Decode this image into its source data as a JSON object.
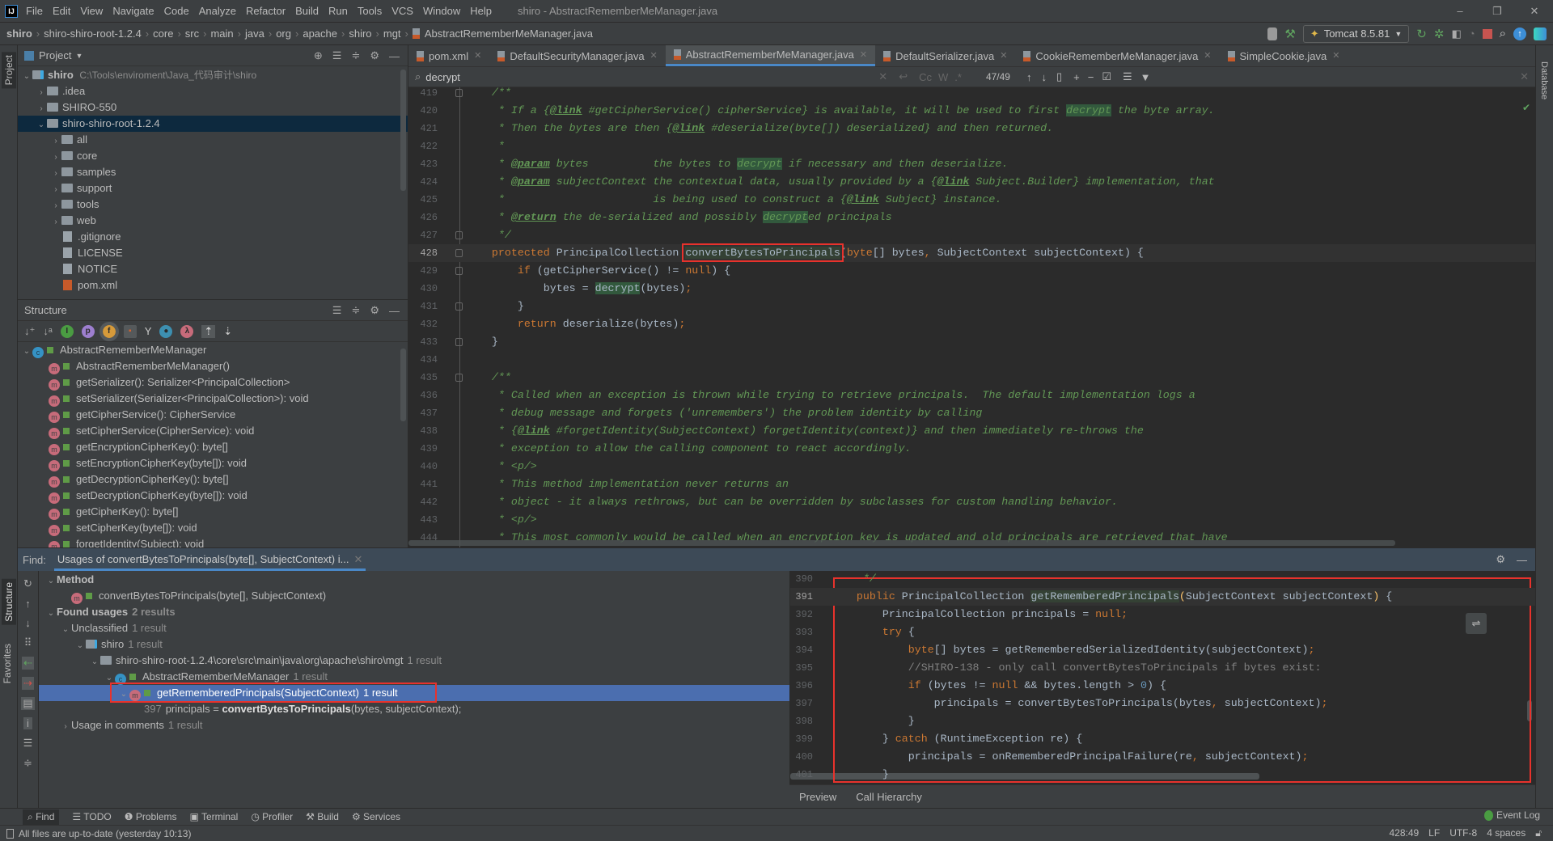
{
  "window": {
    "title": "shiro - AbstractRememberMeManager.java",
    "minimize": "–",
    "maximize": "❐",
    "close": "✕"
  },
  "menu": [
    "File",
    "Edit",
    "View",
    "Navigate",
    "Code",
    "Analyze",
    "Refactor",
    "Build",
    "Run",
    "Tools",
    "VCS",
    "Window",
    "Help"
  ],
  "breadcrumb": [
    "shiro",
    "shiro-shiro-root-1.2.4",
    "core",
    "src",
    "main",
    "java",
    "org",
    "apache",
    "shiro",
    "mgt",
    "AbstractRememberMeManager.java"
  ],
  "toolbar": {
    "run_config": "Tomcat 8.5.81"
  },
  "left_strip": {
    "project": "Project",
    "structure": "Structure",
    "favorites": "Favorites"
  },
  "right_strip": {
    "database": "Database"
  },
  "project": {
    "title": "Project",
    "root": {
      "name": "shiro",
      "path": "C:\\Tools\\enviroment\\Java_代码审计\\shiro"
    },
    "items": [
      {
        "name": ".idea",
        "type": "folder",
        "depth": 1,
        "arrow": "›"
      },
      {
        "name": "SHIRO-550",
        "type": "folder",
        "depth": 1,
        "arrow": "›"
      },
      {
        "name": "shiro-shiro-root-1.2.4",
        "type": "folder",
        "depth": 1,
        "arrow": "⌄",
        "selected": true
      },
      {
        "name": "all",
        "type": "folder",
        "depth": 2,
        "arrow": "›"
      },
      {
        "name": "core",
        "type": "folder",
        "depth": 2,
        "arrow": "›"
      },
      {
        "name": "samples",
        "type": "folder",
        "depth": 2,
        "arrow": "›"
      },
      {
        "name": "support",
        "type": "folder",
        "depth": 2,
        "arrow": "›"
      },
      {
        "name": "tools",
        "type": "folder",
        "depth": 2,
        "arrow": "›"
      },
      {
        "name": "web",
        "type": "folder",
        "depth": 2,
        "arrow": "›"
      },
      {
        "name": ".gitignore",
        "type": "file",
        "depth": 2,
        "arrow": ""
      },
      {
        "name": "LICENSE",
        "type": "file",
        "depth": 2,
        "arrow": ""
      },
      {
        "name": "NOTICE",
        "type": "file",
        "depth": 2,
        "arrow": ""
      },
      {
        "name": "pom.xml",
        "type": "xml",
        "depth": 2,
        "arrow": ""
      }
    ]
  },
  "structure": {
    "title": "Structure",
    "class_name": "AbstractRememberMeManager",
    "members": [
      "AbstractRememberMeManager()",
      "getSerializer(): Serializer<PrincipalCollection>",
      "setSerializer(Serializer<PrincipalCollection>): void",
      "getCipherService(): CipherService",
      "setCipherService(CipherService): void",
      "getEncryptionCipherKey(): byte[]",
      "setEncryptionCipherKey(byte[]): void",
      "getDecryptionCipherKey(): byte[]",
      "setDecryptionCipherKey(byte[]): void",
      "getCipherKey(): byte[]",
      "setCipherKey(byte[]): void",
      "forgetIdentity(Subject): void"
    ]
  },
  "tabs": [
    {
      "label": "pom.xml",
      "icon": "xml-file-icon"
    },
    {
      "label": "DefaultSecurityManager.java",
      "icon": "java-file-icon"
    },
    {
      "label": "AbstractRememberMeManager.java",
      "icon": "java-file-icon",
      "active": true
    },
    {
      "label": "DefaultSerializer.java",
      "icon": "java-file-icon"
    },
    {
      "label": "CookieRememberMeManager.java",
      "icon": "java-file-icon"
    },
    {
      "label": "SimpleCookie.java",
      "icon": "java-file-icon"
    }
  ],
  "search": {
    "query": "decrypt",
    "match_count": "47/49",
    "case_label": "Cc",
    "words_label": "W",
    "regex_label": ".*"
  },
  "editor": {
    "current_line": 428,
    "lines": [
      {
        "n": "419",
        "t": [
          [
            "    /**",
            "c"
          ]
        ]
      },
      {
        "n": "420",
        "t": [
          [
            "     * If a {",
            "c"
          ],
          [
            "@link",
            "ct"
          ],
          [
            " #getCipherService() cipherService} is available, it will be used to first ",
            "c"
          ],
          [
            "decrypt",
            "cm"
          ],
          [
            " the byte array.",
            "c"
          ]
        ]
      },
      {
        "n": "421",
        "t": [
          [
            "     * Then the bytes are then {",
            "c"
          ],
          [
            "@link",
            "ct"
          ],
          [
            " #deserialize(byte[]) deserialized} and then returned.",
            "c"
          ]
        ]
      },
      {
        "n": "422",
        "t": [
          [
            "     *",
            "c"
          ]
        ]
      },
      {
        "n": "423",
        "t": [
          [
            "     * ",
            "c"
          ],
          [
            "@param",
            "ct"
          ],
          [
            " bytes          the bytes to ",
            "c"
          ],
          [
            "decrypt",
            "cm"
          ],
          [
            " if necessary and then deserialize.",
            "c"
          ]
        ]
      },
      {
        "n": "424",
        "t": [
          [
            "     * ",
            "c"
          ],
          [
            "@param",
            "ct"
          ],
          [
            " subjectContext the contextual data, usually provided by a {",
            "c"
          ],
          [
            "@link",
            "ct"
          ],
          [
            " Subject.Builder} implementation, that",
            "c"
          ]
        ]
      },
      {
        "n": "425",
        "t": [
          [
            "     *                       is being used to construct a {",
            "c"
          ],
          [
            "@link",
            "ct"
          ],
          [
            " Subject} instance.",
            "c"
          ]
        ]
      },
      {
        "n": "426",
        "t": [
          [
            "     * ",
            "c"
          ],
          [
            "@return",
            "ct"
          ],
          [
            " the de-serialized and possibly ",
            "c"
          ],
          [
            "decrypt",
            "cm"
          ],
          [
            "ed principals",
            "c"
          ]
        ]
      },
      {
        "n": "427",
        "t": [
          [
            "     */",
            "c"
          ]
        ]
      },
      {
        "n": "428",
        "t": [
          [
            "    ",
            ""
          ],
          [
            "protected",
            "k"
          ],
          [
            " PrincipalCollection ",
            ""
          ],
          [
            "convertBytesToPrincipals",
            "box"
          ],
          [
            "(",
            ""
          ],
          [
            "byte",
            "k"
          ],
          [
            "[] bytes",
            ""
          ],
          [
            ", ",
            "k"
          ],
          [
            "SubjectContext subjectContext) {",
            ""
          ]
        ]
      },
      {
        "n": "429",
        "t": [
          [
            "        ",
            ""
          ],
          [
            "if",
            "k"
          ],
          [
            " (getCipherService() != ",
            ""
          ],
          [
            "null",
            "k"
          ],
          [
            ") {",
            ""
          ]
        ]
      },
      {
        "n": "430",
        "t": [
          [
            "            bytes = ",
            ""
          ],
          [
            "decrypt",
            "m"
          ],
          [
            "(bytes)",
            ""
          ],
          [
            ";",
            "k"
          ]
        ]
      },
      {
        "n": "431",
        "t": [
          [
            "        }",
            ""
          ]
        ]
      },
      {
        "n": "432",
        "t": [
          [
            "        ",
            ""
          ],
          [
            "return",
            "k"
          ],
          [
            " deserialize(bytes)",
            ""
          ],
          [
            ";",
            "k"
          ]
        ]
      },
      {
        "n": "433",
        "t": [
          [
            "    }",
            ""
          ]
        ]
      },
      {
        "n": "434",
        "t": [
          [
            "",
            ""
          ]
        ]
      },
      {
        "n": "435",
        "t": [
          [
            "    /**",
            "c"
          ]
        ]
      },
      {
        "n": "436",
        "t": [
          [
            "     * Called when an exception is thrown while trying to retrieve principals.  The default implementation logs a",
            "c"
          ]
        ]
      },
      {
        "n": "437",
        "t": [
          [
            "     * debug message and forgets ('unremembers') the problem identity by calling",
            "c"
          ]
        ]
      },
      {
        "n": "438",
        "t": [
          [
            "     * {",
            "c"
          ],
          [
            "@link",
            "ct"
          ],
          [
            " #forgetIdentity(SubjectContext) forgetIdentity(context)} and then immediately re-throws the",
            "c"
          ]
        ]
      },
      {
        "n": "439",
        "t": [
          [
            "     * exception to allow the calling component to react accordingly.",
            "c"
          ]
        ]
      },
      {
        "n": "440",
        "t": [
          [
            "     * <p/>",
            "c"
          ]
        ]
      },
      {
        "n": "441",
        "t": [
          [
            "     * This method implementation never returns an",
            "c"
          ]
        ]
      },
      {
        "n": "442",
        "t": [
          [
            "     * object - it always rethrows, but can be overridden by subclasses for custom handling behavior.",
            "c"
          ]
        ]
      },
      {
        "n": "443",
        "t": [
          [
            "     * <p/>",
            "c"
          ]
        ]
      },
      {
        "n": "444",
        "t": [
          [
            "     * This most commonly would be called when an encryption key is updated and old principals are retrieved that have",
            "c"
          ]
        ]
      }
    ]
  },
  "find": {
    "label": "Find:",
    "tab_title": "Usages of convertBytesToPrincipals(byte[], SubjectContext) i...",
    "rows": [
      {
        "depth": 0,
        "arrow": "⌄",
        "icon": "",
        "text": "Method",
        "bold": true,
        "count": ""
      },
      {
        "depth": 1,
        "arrow": "",
        "icon": "method",
        "text": "convertBytesToPrincipals(byte[], SubjectContext)",
        "count": ""
      },
      {
        "depth": 0,
        "arrow": "⌄",
        "icon": "",
        "text": "Found usages",
        "bold": true,
        "count": "2 results"
      },
      {
        "depth": 1,
        "arrow": "⌄",
        "icon": "",
        "text": "Unclassified",
        "count": "1 result"
      },
      {
        "depth": 2,
        "arrow": "⌄",
        "icon": "module",
        "text": "shiro",
        "count": "1 result"
      },
      {
        "depth": 3,
        "arrow": "⌄",
        "icon": "folder",
        "text": "shiro-shiro-root-1.2.4\\core\\src\\main\\java\\org\\apache\\shiro\\mgt",
        "count": "1 result"
      },
      {
        "depth": 4,
        "arrow": "⌄",
        "icon": "class",
        "text": "AbstractRememberMeManager",
        "count": "1 result"
      },
      {
        "depth": 5,
        "arrow": "⌄",
        "icon": "method",
        "text": "getRememberedPrincipals(SubjectContext)",
        "count": "1 result",
        "selected": true
      },
      {
        "depth": 6,
        "arrow": "",
        "icon": "",
        "line": "397",
        "pre": "principals = ",
        "match": "convertBytesToPrincipals",
        "post": "(bytes, subjectContext);"
      },
      {
        "depth": 1,
        "arrow": "›",
        "icon": "",
        "text": "Usage in comments",
        "count": "1 result"
      }
    ]
  },
  "preview": {
    "current_line": 391,
    "tabs": [
      "Preview",
      "Call Hierarchy"
    ],
    "lines": [
      {
        "n": "390",
        "t": [
          [
            "     */",
            "c"
          ]
        ]
      },
      {
        "n": "391",
        "t": [
          [
            "    ",
            ""
          ],
          [
            "public",
            "k"
          ],
          [
            " PrincipalCollection ",
            ""
          ],
          [
            "getRememberedPrincipals",
            "decl"
          ],
          [
            "(",
            "y"
          ],
          [
            "SubjectContext subjectContext",
            ""
          ],
          [
            ")",
            "y"
          ],
          [
            " {",
            ""
          ]
        ]
      },
      {
        "n": "392",
        "t": [
          [
            "        PrincipalCollection principals = ",
            ""
          ],
          [
            "null;",
            "k"
          ]
        ]
      },
      {
        "n": "393",
        "t": [
          [
            "        ",
            ""
          ],
          [
            "try",
            "k"
          ],
          [
            " {",
            ""
          ]
        ]
      },
      {
        "n": "394",
        "t": [
          [
            "            ",
            ""
          ],
          [
            "byte",
            "k"
          ],
          [
            "[] bytes = getRememberedSerializedIdentity(subjectContext)",
            ""
          ],
          [
            ";",
            "k"
          ]
        ]
      },
      {
        "n": "395",
        "t": [
          [
            "            //SHIRO-138 - only call convertBytesToPrincipals if bytes exist:",
            "lc"
          ]
        ]
      },
      {
        "n": "396",
        "t": [
          [
            "            ",
            ""
          ],
          [
            "if",
            "k"
          ],
          [
            " (bytes != ",
            ""
          ],
          [
            "null",
            "k"
          ],
          [
            " && bytes.length > ",
            ""
          ],
          [
            "0",
            "num"
          ],
          [
            ") {",
            ""
          ]
        ]
      },
      {
        "n": "397",
        "t": [
          [
            "                principals = convertBytesToPrincipals(bytes",
            ""
          ],
          [
            ", ",
            "k"
          ],
          [
            "subjectContext)",
            ""
          ],
          [
            ";",
            "k"
          ]
        ]
      },
      {
        "n": "398",
        "t": [
          [
            "            }",
            ""
          ]
        ]
      },
      {
        "n": "399",
        "t": [
          [
            "        } ",
            ""
          ],
          [
            "catch",
            "k"
          ],
          [
            " (RuntimeException re) {",
            ""
          ]
        ]
      },
      {
        "n": "400",
        "t": [
          [
            "            principals = onRememberedPrincipalFailure(re",
            ""
          ],
          [
            ", ",
            "k"
          ],
          [
            "subjectContext)",
            ""
          ],
          [
            ";",
            "k"
          ]
        ]
      },
      {
        "n": "401",
        "t": [
          [
            "        }",
            ""
          ]
        ]
      }
    ]
  },
  "bottom_tools": [
    "Find",
    "TODO",
    "Problems",
    "Terminal",
    "Profiler",
    "Build",
    "Services"
  ],
  "bottom_tools_right": "Event Log",
  "status": {
    "message": "All files are up-to-date (yesterday 10:13)",
    "position": "428:49",
    "line_sep": "LF",
    "encoding": "UTF-8",
    "indent": "4 spaces"
  }
}
